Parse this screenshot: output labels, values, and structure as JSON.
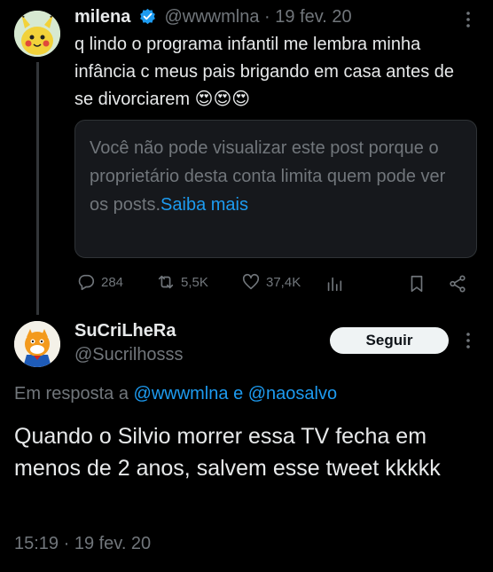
{
  "first_tweet": {
    "author_name": "milena",
    "author_handle": "@wwwmlna",
    "separator": "·",
    "date": "19 fev. 20",
    "text": "q lindo o programa infantil me lembra minha infância c meus pais brigando em casa antes de se divorciarem 😍😍😍",
    "notice_text": "Você não pode visualizar este post porque o proprietário desta conta limita quem pode ver os posts.",
    "notice_link": "Saiba mais",
    "actions": {
      "replies": "284",
      "reposts": "5,5K",
      "likes": "37,4K"
    }
  },
  "second_tweet": {
    "author_name": "SuCriLheRa",
    "author_handle": "@Sucrilhosss",
    "follow_label": "Seguir",
    "reply_prefix": "Em resposta a",
    "reply_handle_1": "@wwwmlna",
    "reply_and": "e",
    "reply_handle_2": "@naosalvo",
    "text": "Quando o Silvio morrer essa TV fecha em menos de 2 anos, salvem esse tweet kkkkk",
    "timestamp": "15:19 · 19 fev. 20"
  },
  "icons": [
    "more-icon",
    "verified-badge-icon",
    "reply-icon",
    "repost-icon",
    "like-icon",
    "views-icon",
    "bookmark-icon",
    "share-icon"
  ],
  "colors": {
    "background": "#000000",
    "text": "#e7e9ea",
    "muted": "#71767b",
    "link": "#1d9bf0",
    "verified": "#1d9bf0"
  }
}
